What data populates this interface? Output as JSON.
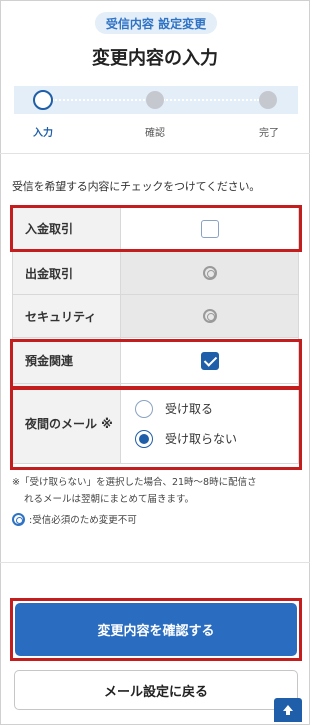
{
  "header": {
    "badge": "受信内容 設定変更",
    "title": "変更内容の入力"
  },
  "steps": [
    {
      "label": "入力",
      "active": true
    },
    {
      "label": "確認",
      "active": false
    },
    {
      "label": "完了",
      "active": false
    }
  ],
  "instruction": "受信を希望する内容にチェックをつけてください。",
  "options": {
    "deposit": {
      "label": "入金取引",
      "checked": false
    },
    "withdrawal": {
      "label": "出金取引",
      "state": "fixed"
    },
    "security": {
      "label": "セキュリティ",
      "state": "fixed"
    },
    "savings": {
      "label": "預金関連",
      "checked": true
    },
    "night_mail": {
      "label": "夜間のメール ※",
      "choices": [
        {
          "label": "受け取る",
          "selected": false
        },
        {
          "label": "受け取らない",
          "selected": true
        }
      ]
    }
  },
  "note": {
    "line1": "※「受け取らない」を選択した場合、21時〜8時に配信さ",
    "line2": "れるメールは翌朝にまとめて届きます。"
  },
  "legend": ":受信必須のため変更不可",
  "buttons": {
    "confirm": "変更内容を確認する",
    "back": "メール設定に戻る"
  },
  "colors": {
    "primary": "#2a6cc0",
    "highlight": "#c41d1d",
    "stepper_bg": "#e3eef9"
  }
}
